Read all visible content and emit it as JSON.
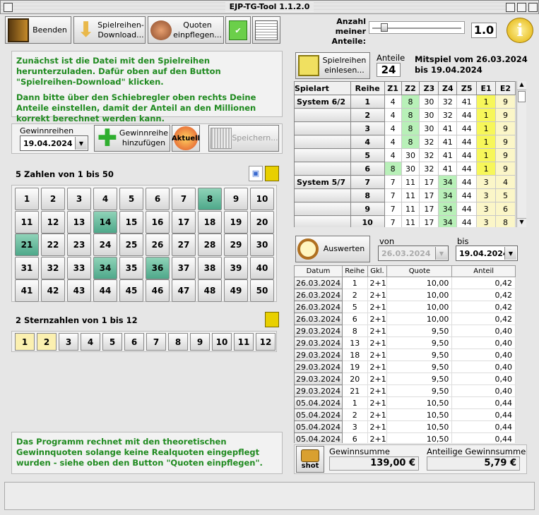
{
  "window": {
    "title": "EJP-TG-Tool 1.1.2.0"
  },
  "toolbar": {
    "beenden": "Beenden",
    "download": "Spielreihen-\nDownload...",
    "quoten": "Quoten\neinpflegen...",
    "anteile_label": "Anzahl meiner\nAnteile:",
    "anteile_value": "1.0",
    "info_icon": "i"
  },
  "info_text": {
    "p1": "Zunächst ist die Datei mit den Spielreihen herunterzuladen. Dafür oben auf den Button \"Spielreihen-Download\" klicken.",
    "p2": "Dann bitte über den Schiebregler oben rechts Deine Anteile einstellen, damit der Anteil an den Millionen korrekt berechnet werden kann."
  },
  "gewinnreihen": {
    "label": "Gewinnreihen",
    "date": "19.04.2024",
    "add_btn": "Gewinnreihe\nhinzufügen",
    "aktuell": "Aktuell",
    "save_btn": "Speichern..."
  },
  "zahlen": {
    "title": "5 Zahlen von 1 bis 50",
    "selected": [
      8,
      14,
      21,
      34,
      36
    ]
  },
  "sterne": {
    "title": "2 Sternzahlen von 1 bis 12",
    "selected": [
      1,
      2
    ]
  },
  "footer_text": "Das Programm rechnet mit den theoretischen Gewinnquoten solange keine Realquoten eingepflegt wurden - siehe oben den Button \"Quoten einpflegen\".",
  "spielreihen": {
    "btn": "Spielreihen\neinlesen...",
    "anteile_label": "Anteile",
    "anteile_value": "24",
    "mitspiel": "Mitspiel vom 26.03.2024\nbis 19.04.2024",
    "headers": [
      "Spielart",
      "Reihe",
      "Z1",
      "Z2",
      "Z3",
      "Z4",
      "Z5",
      "E1",
      "E2"
    ],
    "rows": [
      {
        "art": "System 6/2",
        "r": "1",
        "z": [
          "4",
          "8",
          "30",
          "32",
          "41"
        ],
        "e": [
          "1",
          "9"
        ]
      },
      {
        "art": "",
        "r": "2",
        "z": [
          "4",
          "8",
          "30",
          "32",
          "44"
        ],
        "e": [
          "1",
          "9"
        ]
      },
      {
        "art": "",
        "r": "3",
        "z": [
          "4",
          "8",
          "30",
          "41",
          "44"
        ],
        "e": [
          "1",
          "9"
        ]
      },
      {
        "art": "",
        "r": "4",
        "z": [
          "4",
          "8",
          "32",
          "41",
          "44"
        ],
        "e": [
          "1",
          "9"
        ]
      },
      {
        "art": "",
        "r": "5",
        "z": [
          "4",
          "30",
          "32",
          "41",
          "44"
        ],
        "e": [
          "1",
          "9"
        ]
      },
      {
        "art": "",
        "r": "6",
        "z": [
          "8",
          "30",
          "32",
          "41",
          "44"
        ],
        "e": [
          "1",
          "9"
        ]
      },
      {
        "art": "System 5/7",
        "r": "7",
        "z": [
          "7",
          "11",
          "17",
          "34",
          "44"
        ],
        "e": [
          "3",
          "4"
        ]
      },
      {
        "art": "",
        "r": "8",
        "z": [
          "7",
          "11",
          "17",
          "34",
          "44"
        ],
        "e": [
          "3",
          "5"
        ]
      },
      {
        "art": "",
        "r": "9",
        "z": [
          "7",
          "11",
          "17",
          "34",
          "44"
        ],
        "e": [
          "3",
          "6"
        ]
      },
      {
        "art": "",
        "r": "10",
        "z": [
          "7",
          "11",
          "17",
          "34",
          "44"
        ],
        "e": [
          "3",
          "8"
        ]
      }
    ]
  },
  "auswertung": {
    "btn": "Auswerten",
    "von_label": "von",
    "von_date": "26.03.2024",
    "bis_label": "bis",
    "bis_date": "19.04.2024",
    "headers": [
      "Datum",
      "Reihe",
      "Gkl.",
      "Quote",
      "Anteil"
    ],
    "rows": [
      [
        "26.03.2024",
        "1",
        "2+1",
        "10,00",
        "0,42"
      ],
      [
        "26.03.2024",
        "2",
        "2+1",
        "10,00",
        "0,42"
      ],
      [
        "26.03.2024",
        "5",
        "2+1",
        "10,00",
        "0,42"
      ],
      [
        "26.03.2024",
        "6",
        "2+1",
        "10,00",
        "0,42"
      ],
      [
        "29.03.2024",
        "8",
        "2+1",
        "9,50",
        "0,40"
      ],
      [
        "29.03.2024",
        "13",
        "2+1",
        "9,50",
        "0,40"
      ],
      [
        "29.03.2024",
        "18",
        "2+1",
        "9,50",
        "0,40"
      ],
      [
        "29.03.2024",
        "19",
        "2+1",
        "9,50",
        "0,40"
      ],
      [
        "29.03.2024",
        "20",
        "2+1",
        "9,50",
        "0,40"
      ],
      [
        "29.03.2024",
        "21",
        "2+1",
        "9,50",
        "0,40"
      ],
      [
        "05.04.2024",
        "1",
        "2+1",
        "10,50",
        "0,44"
      ],
      [
        "05.04.2024",
        "2",
        "2+1",
        "10,50",
        "0,44"
      ],
      [
        "05.04.2024",
        "3",
        "2+1",
        "10,50",
        "0,44"
      ],
      [
        "05.04.2024",
        "6",
        "2+1",
        "10,50",
        "0,44"
      ]
    ],
    "shot": "shot",
    "summe_label": "Gewinnsumme",
    "summe_value": "139,00 €",
    "anteil_label": "Anteilige Gewinnsumme",
    "anteil_value": "5,79 €"
  },
  "colors": {
    "selected_number": "#5cb394",
    "selected_star": "#fbf0b0",
    "match_green": "#b8f0b8",
    "match_yellow": "#f7f75a"
  }
}
